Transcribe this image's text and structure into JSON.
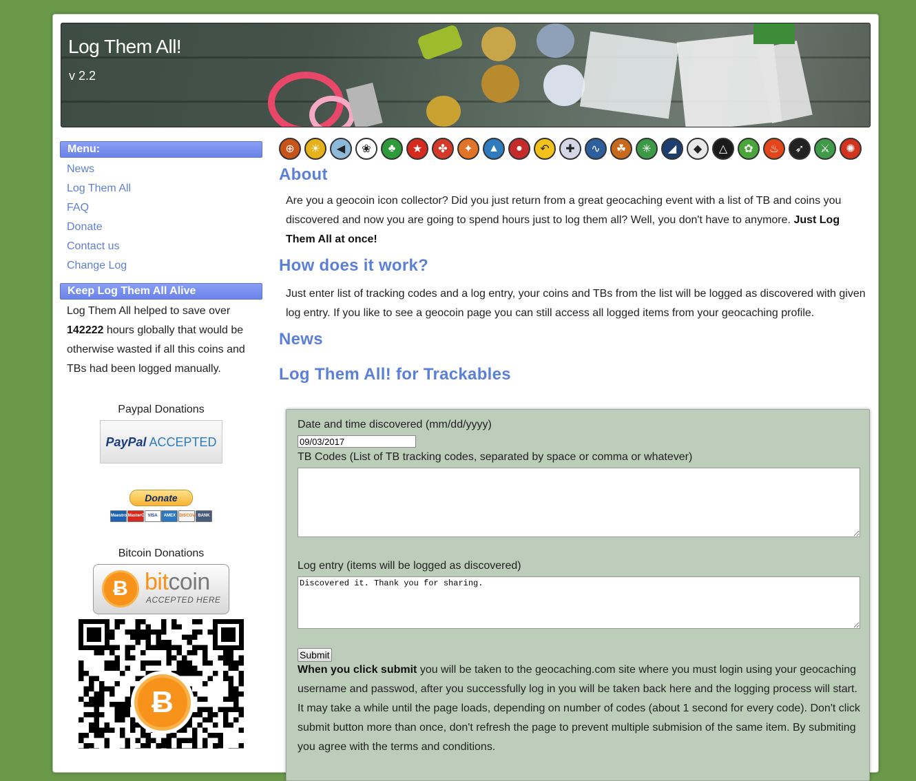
{
  "header": {
    "title": "Log Them All!",
    "version": "v 2.2"
  },
  "sidebar": {
    "menu_title": "Menu:",
    "menu_items": [
      "News",
      "Log Them All",
      "FAQ",
      "Donate",
      "Contact us",
      "Change Log"
    ],
    "alive_title": "Keep Log Them All Alive",
    "alive_text_1": "Log Them All helped to save over",
    "alive_hours": "142222",
    "alive_text_2": "hours globally that would be otherwise wasted if all this coins and TBs had been logged manually.",
    "paypal_label": "Paypal Donations",
    "paypal_badge_1": "PayPal",
    "paypal_badge_2": "ACCEPTED",
    "donate_button": "Donate",
    "card_logos": [
      "Maestro",
      "MasterCard",
      "VISA",
      "AMEX",
      "DISCOVER",
      "BANK"
    ],
    "bitcoin_label": "Bitcoin Donations",
    "bitcoin_badge_word_1": "bit",
    "bitcoin_badge_word_2": "coin",
    "bitcoin_badge_sub": "ACCEPTED HERE",
    "bitcoin_symbol": "Ƀ"
  },
  "icon_strip": [
    {
      "name": "crosshair-icon",
      "color": "#c9541a",
      "glyph": "⊕"
    },
    {
      "name": "sunflower-icon",
      "color": "#e6b21c",
      "glyph": "☀"
    },
    {
      "name": "blue-arrow-icon",
      "color": "#8fb9d8",
      "glyph": "◀"
    },
    {
      "name": "paw-icon",
      "color": "#ffffff",
      "glyph": "❀"
    },
    {
      "name": "shamrock-icon",
      "color": "#2f9a3a",
      "glyph": "♣"
    },
    {
      "name": "china-flag-icon",
      "color": "#d42b1e",
      "glyph": "★"
    },
    {
      "name": "canada-flag-icon",
      "color": "#d43a2a",
      "glyph": "✤"
    },
    {
      "name": "compass-star-icon",
      "color": "#e0752a",
      "glyph": "✦"
    },
    {
      "name": "hiker-icon",
      "color": "#2f7bbd",
      "glyph": "▲"
    },
    {
      "name": "mushroom-icon",
      "color": "#c42b2b",
      "glyph": "●"
    },
    {
      "name": "road-sign-icon",
      "color": "#f2c21a",
      "glyph": "↶"
    },
    {
      "name": "slovakia-shield-icon",
      "color": "#d6d6e6",
      "glyph": "✚"
    },
    {
      "name": "wave-icon",
      "color": "#2c5f9c",
      "glyph": "∿"
    },
    {
      "name": "maple-leaf-icon",
      "color": "#c86a1e",
      "glyph": "☘"
    },
    {
      "name": "palm-icon",
      "color": "#3c9a46",
      "glyph": "✳"
    },
    {
      "name": "orca-icon",
      "color": "#1c3f6e",
      "glyph": "◢"
    },
    {
      "name": "penguin-icon",
      "color": "#e8e8e8",
      "glyph": "◆"
    },
    {
      "name": "prism-icon",
      "color": "#1a1a1a",
      "glyph": "△"
    },
    {
      "name": "bp-flower-icon",
      "color": "#4aa63a",
      "glyph": "✿"
    },
    {
      "name": "flame-icon",
      "color": "#e2461a",
      "glyph": "♨"
    },
    {
      "name": "rocket-icon",
      "color": "#222222",
      "glyph": "➶"
    },
    {
      "name": "dragon-icon",
      "color": "#3f9a4a",
      "glyph": "⚔"
    },
    {
      "name": "triskele-icon",
      "color": "#d2331e",
      "glyph": "✺"
    }
  ],
  "main": {
    "about_title": "About",
    "about_text": "Are you a geocoin icon collector? Did you just return from a great geocaching event with a list of TB and coins you discovered and now you are going to spend hours just to log them all? Well, you don't have to anymore.",
    "about_bold": "Just Log Them All at once!",
    "how_title": "How does it work?",
    "how_text": "Just enter list of tracking codes and a log entry, your coins and TBs from the list will be logged as discovered with given log entry. If you like to see a geocoin page you can still access all logged items from your geocaching profile.",
    "news_title": "News",
    "form_title": "Log Them All! for Trackables"
  },
  "form": {
    "date_label": "Date and time discovered (mm/dd/yyyy)",
    "date_value": "09/03/2017",
    "codes_label": "TB Codes (List of TB tracking codes, separated by space or comma or whatever)",
    "codes_value": "",
    "log_label": "Log entry (items will be logged as discovered)",
    "log_value": "Discovered it. Thank you for sharing.",
    "submit_label": "Submit",
    "note_bold": "When you click submit",
    "note_text": "you will be taken to the geocaching.com site where you must login using your geocaching username and passwod, after you successfully log in you will be taken back here and the logging process will start. It may take a while until the page loads, depending on number of codes (about 1 second for every code). Don't click submit button more than once, don't refresh the page to prevent multiple submision of the same item. By submiting you agree with the terms and conditions."
  }
}
